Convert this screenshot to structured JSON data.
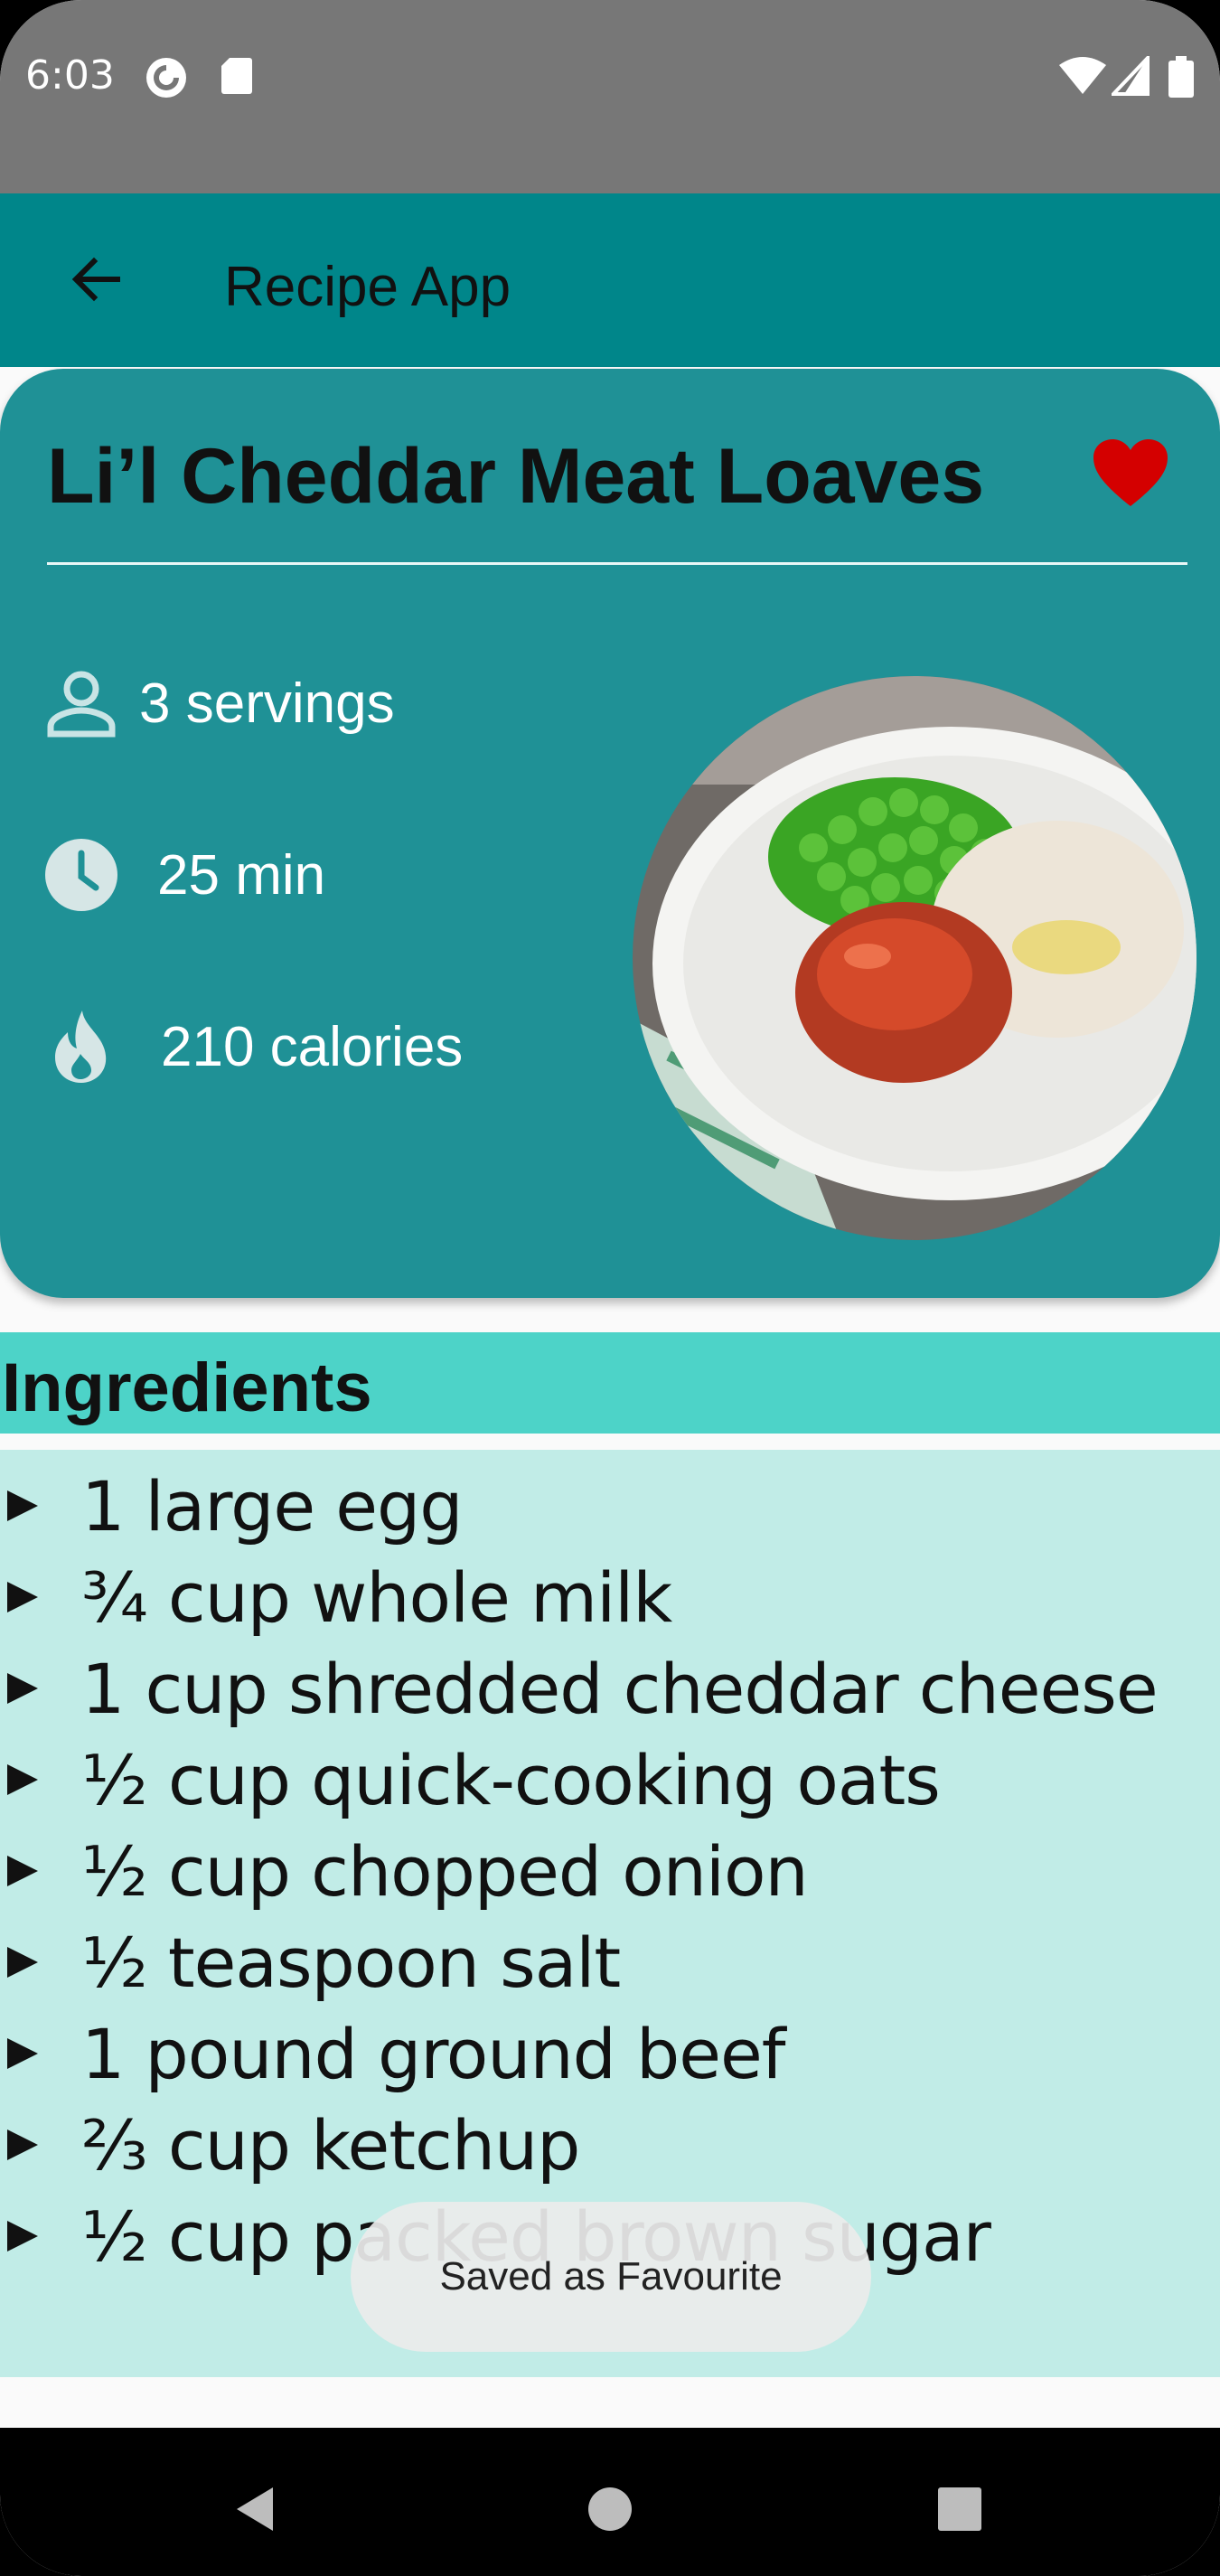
{
  "status_bar": {
    "time": "6:03",
    "icons": [
      "pocket-casts-icon",
      "sd-card-icon",
      "wifi-icon",
      "signal-icon",
      "battery-icon"
    ]
  },
  "app_bar": {
    "title": "Recipe App",
    "back_icon": "arrow-back-icon"
  },
  "recipe": {
    "title": "Li’l Cheddar Meat Loaves",
    "favourite": true,
    "servings": "3 servings",
    "time": "25 min",
    "calories": "210 calories",
    "image": "meat-loaf-plate-photo"
  },
  "ingredients": {
    "title": "Ingredients",
    "items": [
      "1 large egg",
      "¾ cup whole milk",
      "1 cup shredded cheddar cheese",
      "½ cup quick-cooking oats",
      "½ cup chopped onion",
      "½ teaspoon salt",
      "1 pound ground beef",
      "⅔ cup ketchup",
      "½ cup packed brown sugar"
    ]
  },
  "toast": {
    "message": "Saved as Favourite"
  },
  "nav_bar": {
    "buttons": [
      "back-nav-icon",
      "home-nav-icon",
      "recents-nav-icon"
    ]
  },
  "colors": {
    "status_bar": "#777777",
    "app_bar": "#00868a",
    "card": "#1f9196",
    "ingredients_header": "#4dd3c8",
    "ingredients_body": "#c1ece7",
    "favourite_heart": "#d40000"
  }
}
